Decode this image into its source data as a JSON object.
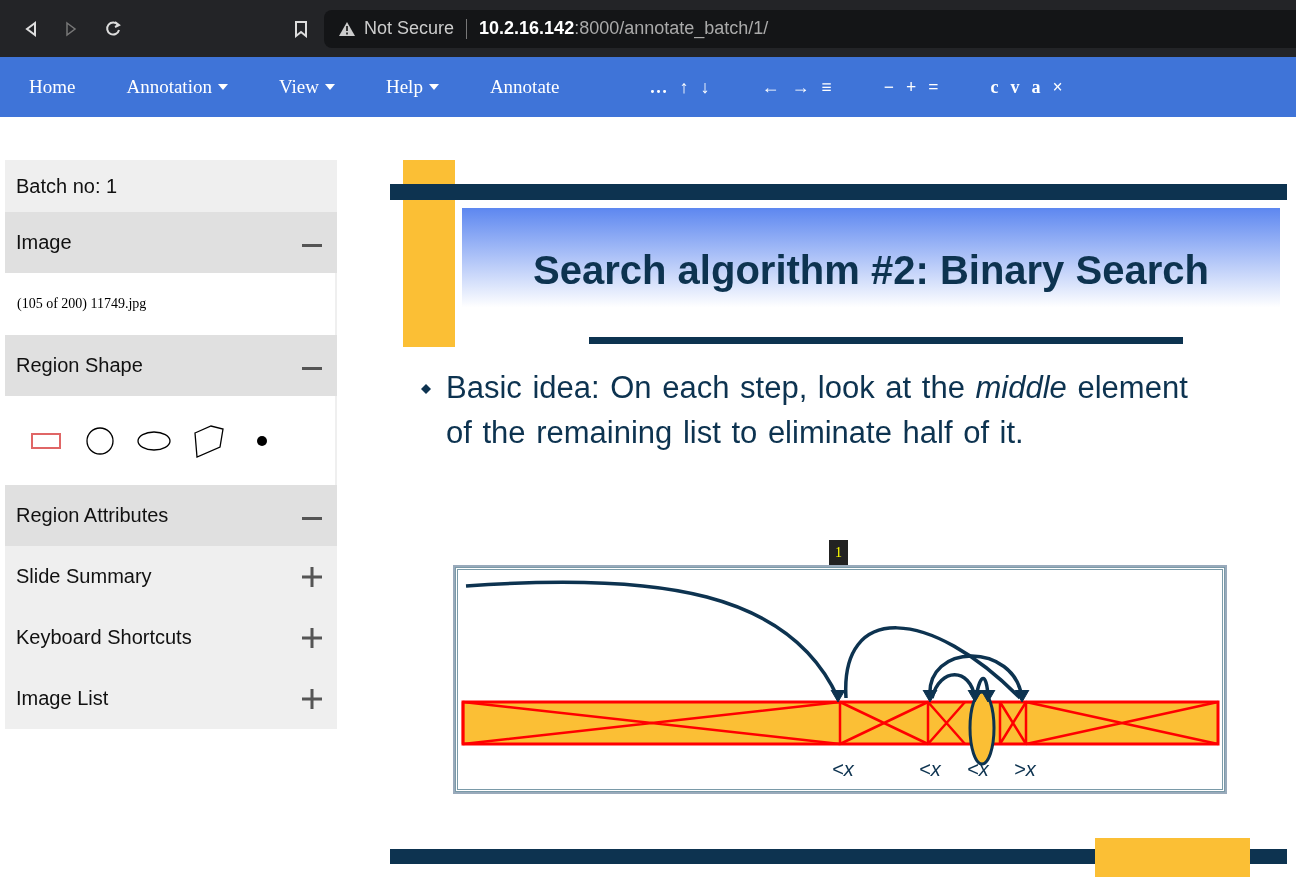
{
  "browser": {
    "security": "Not Secure",
    "url_host": "10.2.16.142",
    "url_rest": ":8000/annotate_batch/1/"
  },
  "navbar": {
    "items": [
      {
        "label": "Home",
        "dropdown": false
      },
      {
        "label": "Annotation",
        "dropdown": true
      },
      {
        "label": "View",
        "dropdown": true
      },
      {
        "label": "Help",
        "dropdown": true
      },
      {
        "label": "Annotate",
        "dropdown": false
      }
    ],
    "tool_groups": [
      [
        "…",
        "↑",
        "↓"
      ],
      [
        "←",
        "→",
        "≡"
      ],
      [
        "−",
        "+",
        "="
      ],
      [
        "c",
        "v",
        "a",
        "×"
      ]
    ]
  },
  "sidebar": {
    "batch": "Batch no: 1",
    "panels": [
      {
        "title": "Image",
        "expanded": true,
        "kind": "info",
        "text": "(105 of 200) 11749.jpg"
      },
      {
        "title": "Region Shape",
        "expanded": true,
        "kind": "shapes",
        "shapes": [
          {
            "kind": "rect",
            "selected": true
          },
          {
            "kind": "circle",
            "selected": false
          },
          {
            "kind": "ellipse",
            "selected": false
          },
          {
            "kind": "polygon",
            "selected": false
          },
          {
            "kind": "point",
            "selected": false
          }
        ]
      },
      {
        "title": "Region Attributes",
        "expanded": true
      },
      {
        "title": "Slide Summary",
        "expanded": false
      },
      {
        "title": "Keyboard Shortcuts",
        "expanded": false
      },
      {
        "title": "Image List",
        "expanded": false
      }
    ]
  },
  "slide": {
    "title": "Search algorithm #2: Binary Search",
    "bullet": "Basic idea: On each step, look at the *middle* element of the remaining list to eliminate half of it.",
    "region_label": "1",
    "diagram_labels": [
      "<*x*",
      "<*x*",
      "<*x*",
      ">*x*"
    ]
  }
}
